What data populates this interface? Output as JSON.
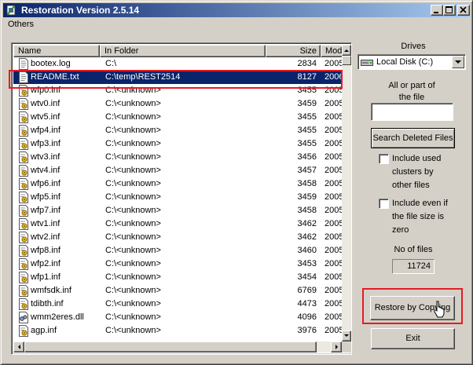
{
  "window": {
    "title": "Restoration Version 2.5.14"
  },
  "menu": {
    "others": "Others"
  },
  "list": {
    "columns": {
      "name": "Name",
      "folder": "In Folder",
      "size": "Size",
      "modified": "Mod"
    },
    "rows": [
      {
        "name": "bootex.log",
        "folder": "C:\\",
        "size": "2834",
        "mod": "2005",
        "icon": "text-file-icon"
      },
      {
        "name": "README.txt",
        "folder": "C:\\temp\\REST2514",
        "size": "8127",
        "mod": "2006",
        "icon": "text-file-icon"
      },
      {
        "name": "wfp0.inf",
        "folder": "C:\\<unknown>",
        "size": "3455",
        "mod": "2005",
        "icon": "inf-file-icon"
      },
      {
        "name": "wtv0.inf",
        "folder": "C:\\<unknown>",
        "size": "3459",
        "mod": "2005",
        "icon": "inf-file-icon"
      },
      {
        "name": "wtv5.inf",
        "folder": "C:\\<unknown>",
        "size": "3455",
        "mod": "2005",
        "icon": "inf-file-icon"
      },
      {
        "name": "wfp4.inf",
        "folder": "C:\\<unknown>",
        "size": "3455",
        "mod": "2005",
        "icon": "inf-file-icon"
      },
      {
        "name": "wfp3.inf",
        "folder": "C:\\<unknown>",
        "size": "3455",
        "mod": "2005",
        "icon": "inf-file-icon"
      },
      {
        "name": "wtv3.inf",
        "folder": "C:\\<unknown>",
        "size": "3456",
        "mod": "2005",
        "icon": "inf-file-icon"
      },
      {
        "name": "wtv4.inf",
        "folder": "C:\\<unknown>",
        "size": "3457",
        "mod": "2005",
        "icon": "inf-file-icon"
      },
      {
        "name": "wfp6.inf",
        "folder": "C:\\<unknown>",
        "size": "3458",
        "mod": "2005",
        "icon": "inf-file-icon"
      },
      {
        "name": "wfp5.inf",
        "folder": "C:\\<unknown>",
        "size": "3459",
        "mod": "2005",
        "icon": "inf-file-icon"
      },
      {
        "name": "wfp7.inf",
        "folder": "C:\\<unknown>",
        "size": "3458",
        "mod": "2005",
        "icon": "inf-file-icon"
      },
      {
        "name": "wtv1.inf",
        "folder": "C:\\<unknown>",
        "size": "3462",
        "mod": "2005",
        "icon": "inf-file-icon"
      },
      {
        "name": "wtv2.inf",
        "folder": "C:\\<unknown>",
        "size": "3462",
        "mod": "2005",
        "icon": "inf-file-icon"
      },
      {
        "name": "wfp8.inf",
        "folder": "C:\\<unknown>",
        "size": "3460",
        "mod": "2005",
        "icon": "inf-file-icon"
      },
      {
        "name": "wfp2.inf",
        "folder": "C:\\<unknown>",
        "size": "3453",
        "mod": "2005",
        "icon": "inf-file-icon"
      },
      {
        "name": "wfp1.inf",
        "folder": "C:\\<unknown>",
        "size": "3454",
        "mod": "2005",
        "icon": "inf-file-icon"
      },
      {
        "name": "wmfsdk.inf",
        "folder": "C:\\<unknown>",
        "size": "6769",
        "mod": "2005",
        "icon": "inf-file-icon"
      },
      {
        "name": "tdibth.inf",
        "folder": "C:\\<unknown>",
        "size": "4473",
        "mod": "2005",
        "icon": "inf-file-icon"
      },
      {
        "name": "wmm2eres.dll",
        "folder": "C:\\<unknown>",
        "size": "4096",
        "mod": "2005",
        "icon": "dll-file-icon"
      },
      {
        "name": "agp.inf",
        "folder": "C:\\<unknown>",
        "size": "3976",
        "mod": "2005",
        "icon": "inf-file-icon"
      }
    ],
    "selected_index": 1
  },
  "panel": {
    "drives_label": "Drives",
    "drive_selected": "Local Disk (C:)",
    "part_file_label_1": "All or part of",
    "part_file_label_2": "the file",
    "file_filter_value": "",
    "search_button": "Search Deleted Files",
    "include_used_1": "Include used",
    "include_used_2": "clusters by",
    "include_used_3": "other files",
    "include_used_checked": false,
    "include_zero_1": "Include even if",
    "include_zero_2": "the file size is",
    "include_zero_3": "zero",
    "include_zero_checked": false,
    "no_files_label": "No of files",
    "no_files_value": "11724",
    "restore_button": "Restore by Copying",
    "exit_button": "Exit"
  },
  "colors": {
    "selection": "#0a246a",
    "highlight_box": "#e51c23",
    "face": "#d4d0c8"
  }
}
